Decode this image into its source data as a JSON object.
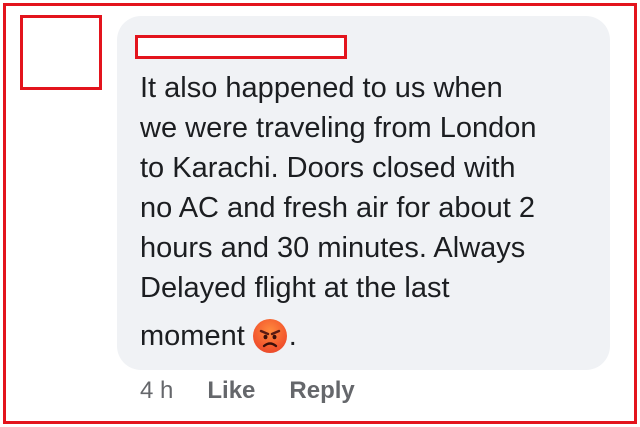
{
  "comment": {
    "lines": [
      "It also happened to us when",
      "we were traveling from London",
      "to Karachi. Doors closed with",
      "no AC and fresh air for about 2",
      "hours and 30 minutes. Always",
      "Delayed flight at the last"
    ],
    "last_line_text": "moment",
    "last_line_suffix": ".",
    "emoji": "angry-face-icon"
  },
  "meta": {
    "timestamp": "4 h",
    "like_label": "Like",
    "reply_label": "Reply"
  },
  "colors": {
    "redaction_border": "#e3141d",
    "bubble_background": "#f0f2f5",
    "text": "#1c1e21",
    "secondary_text": "#65676b"
  }
}
